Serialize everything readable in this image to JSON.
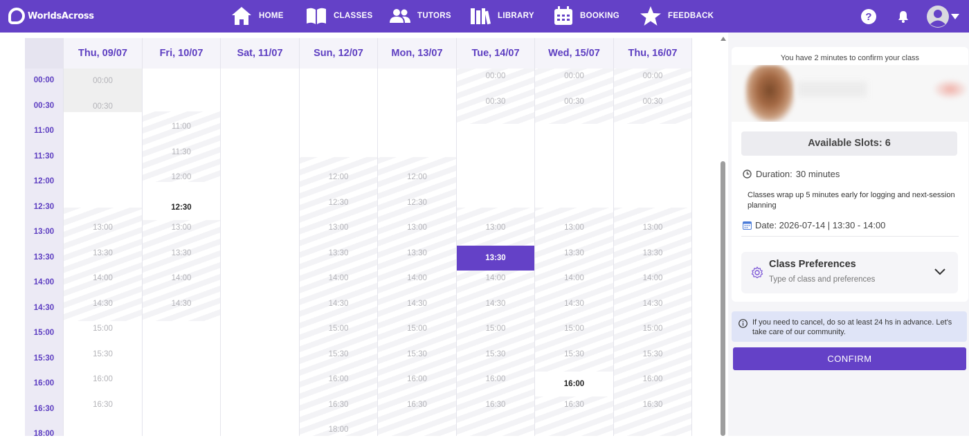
{
  "app": {
    "brand": "WorldsAcross",
    "accent": "#6441c7"
  },
  "nav": {
    "items": [
      {
        "label": "HOME",
        "icon": "home-icon"
      },
      {
        "label": "CLASSES",
        "icon": "book-icon"
      },
      {
        "label": "TUTORS",
        "icon": "users-icon"
      },
      {
        "label": "LIBRARY",
        "icon": "library-icon"
      },
      {
        "label": "BOOKING",
        "icon": "calendar-icon"
      },
      {
        "label": "FEEDBACK",
        "icon": "star-icon"
      }
    ],
    "help_icon": "help-icon",
    "bell_icon": "bell-icon",
    "avatar_icon": "avatar-icon"
  },
  "calendar": {
    "times": [
      "00:00",
      "00:30",
      "11:00",
      "11:30",
      "12:00",
      "12:30",
      "13:00",
      "13:30",
      "14:00",
      "14:30",
      "15:00",
      "15:30",
      "16:00",
      "16:30",
      "18:00"
    ],
    "days": [
      {
        "label": "Thu, 09/07",
        "slots": [
          {
            "t": "00:00",
            "row": 0,
            "s": "gray"
          },
          {
            "t": "00:30",
            "row": 1,
            "s": "gray"
          },
          {
            "t": "13:00",
            "row": 6
          },
          {
            "t": "13:30",
            "row": 7
          },
          {
            "t": "14:00",
            "row": 8
          },
          {
            "t": "14:30",
            "row": 9
          },
          {
            "t": "15:00",
            "row": 10
          },
          {
            "t": "15:30",
            "row": 11
          },
          {
            "t": "16:00",
            "row": 12
          },
          {
            "t": "16:30",
            "row": 13
          }
        ]
      },
      {
        "label": "Fri, 10/07",
        "slots": [
          {
            "t": "11:00",
            "row": 2
          },
          {
            "t": "11:30",
            "row": 3
          },
          {
            "t": "12:00",
            "row": 4
          },
          {
            "t": "12:30",
            "row": 5,
            "s": "dark"
          },
          {
            "t": "13:00",
            "row": 6
          },
          {
            "t": "13:30",
            "row": 7
          },
          {
            "t": "14:00",
            "row": 8
          },
          {
            "t": "14:30",
            "row": 9
          }
        ]
      },
      {
        "label": "Sat, 11/07",
        "slots": []
      },
      {
        "label": "Sun, 12/07",
        "slots": [
          {
            "t": "12:00",
            "row": 4
          },
          {
            "t": "12:30",
            "row": 5
          },
          {
            "t": "13:00",
            "row": 6
          },
          {
            "t": "13:30",
            "row": 7
          },
          {
            "t": "14:00",
            "row": 8
          },
          {
            "t": "14:30",
            "row": 9
          },
          {
            "t": "15:00",
            "row": 10
          },
          {
            "t": "15:30",
            "row": 11
          },
          {
            "t": "16:00",
            "row": 12
          },
          {
            "t": "16:30",
            "row": 13
          },
          {
            "t": "18:00",
            "row": 14
          }
        ]
      },
      {
        "label": "Mon, 13/07",
        "slots": [
          {
            "t": "12:00",
            "row": 4
          },
          {
            "t": "12:30",
            "row": 5
          },
          {
            "t": "13:00",
            "row": 6
          },
          {
            "t": "13:30",
            "row": 7
          },
          {
            "t": "14:00",
            "row": 8
          },
          {
            "t": "14:30",
            "row": 9
          },
          {
            "t": "15:00",
            "row": 10
          },
          {
            "t": "15:30",
            "row": 11
          },
          {
            "t": "16:00",
            "row": 12
          },
          {
            "t": "16:30",
            "row": 13
          }
        ]
      },
      {
        "label": "Tue, 14/07",
        "slots": [
          {
            "t": "00:00",
            "row": 0
          },
          {
            "t": "00:30",
            "row": 1
          },
          {
            "t": "13:00",
            "row": 6
          },
          {
            "t": "13:30",
            "row": 7,
            "s": "sel"
          },
          {
            "t": "14:00",
            "row": 8
          },
          {
            "t": "14:30",
            "row": 9
          },
          {
            "t": "15:00",
            "row": 10
          },
          {
            "t": "15:30",
            "row": 11
          },
          {
            "t": "16:00",
            "row": 12
          },
          {
            "t": "16:30",
            "row": 13
          }
        ]
      },
      {
        "label": "Wed, 15/07",
        "slots": [
          {
            "t": "00:00",
            "row": 0
          },
          {
            "t": "00:30",
            "row": 1
          },
          {
            "t": "13:00",
            "row": 6
          },
          {
            "t": "13:30",
            "row": 7
          },
          {
            "t": "14:00",
            "row": 8
          },
          {
            "t": "14:30",
            "row": 9
          },
          {
            "t": "15:00",
            "row": 10
          },
          {
            "t": "15:30",
            "row": 11
          },
          {
            "t": "16:00",
            "row": 12,
            "s": "dark"
          },
          {
            "t": "16:30",
            "row": 13
          }
        ]
      },
      {
        "label": "Thu, 16/07",
        "slots": [
          {
            "t": "00:00",
            "row": 0
          },
          {
            "t": "00:30",
            "row": 1
          },
          {
            "t": "13:00",
            "row": 6
          },
          {
            "t": "13:30",
            "row": 7
          },
          {
            "t": "14:00",
            "row": 8
          },
          {
            "t": "14:30",
            "row": 9
          },
          {
            "t": "15:00",
            "row": 10
          },
          {
            "t": "15:30",
            "row": 11
          },
          {
            "t": "16:00",
            "row": 12
          },
          {
            "t": "16:30",
            "row": 13
          }
        ]
      }
    ]
  },
  "panel": {
    "confirm_note": "You have 2 minutes to confirm your class",
    "available_slots": "Available Slots: 6",
    "duration_label": "Duration:",
    "duration_value": "30 minutes",
    "wrap_note": "Classes wrap up 5 minutes early for logging and next-session planning",
    "date_text": "Date: 2026-07-14 | 13:30 - 14:00",
    "prefs_title": "Class Preferences",
    "prefs_sub": "Type of class and preferences",
    "cancel_info": "If you need to cancel, do so at least 24 hs in advance. Let's take care of our community.",
    "confirm_label": "CONFIRM"
  }
}
